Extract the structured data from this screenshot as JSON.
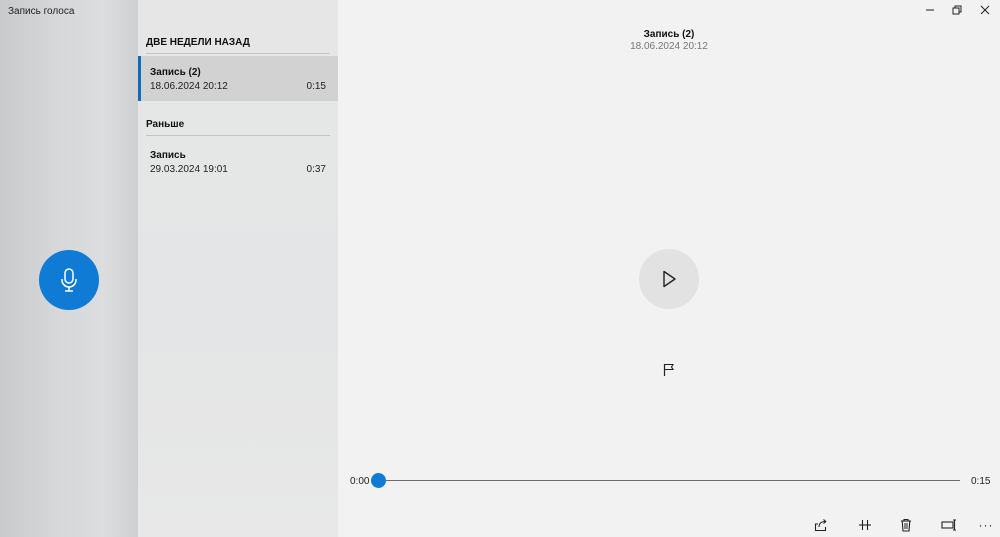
{
  "app": {
    "title": "Запись голоса"
  },
  "groups": [
    {
      "header": "ДВЕ НЕДЕЛИ НАЗАД",
      "items": [
        {
          "name": "Запись (2)",
          "date": "18.06.2024 20:12",
          "duration": "0:15",
          "selected": true
        }
      ]
    },
    {
      "header": "Раньше",
      "items": [
        {
          "name": "Запись",
          "date": "29.03.2024 19:01",
          "duration": "0:37",
          "selected": false
        }
      ]
    }
  ],
  "player": {
    "title": "Запись (2)",
    "date": "18.06.2024 20:12",
    "time_start": "0:00",
    "time_end": "0:15",
    "progress": 0
  },
  "icons": {
    "record": "microphone-icon",
    "play": "play-icon",
    "marker": "flag-icon",
    "share": "share-icon",
    "trim": "trim-icon",
    "delete": "trash-icon",
    "rename": "rename-icon",
    "more": "more-icon",
    "minimize": "minimize-icon",
    "restore": "restore-icon",
    "close": "close-icon"
  },
  "colors": {
    "accent": "#0f7bd5",
    "selection": "#0f6cbd"
  },
  "toolbar": {
    "more_label": "···"
  }
}
